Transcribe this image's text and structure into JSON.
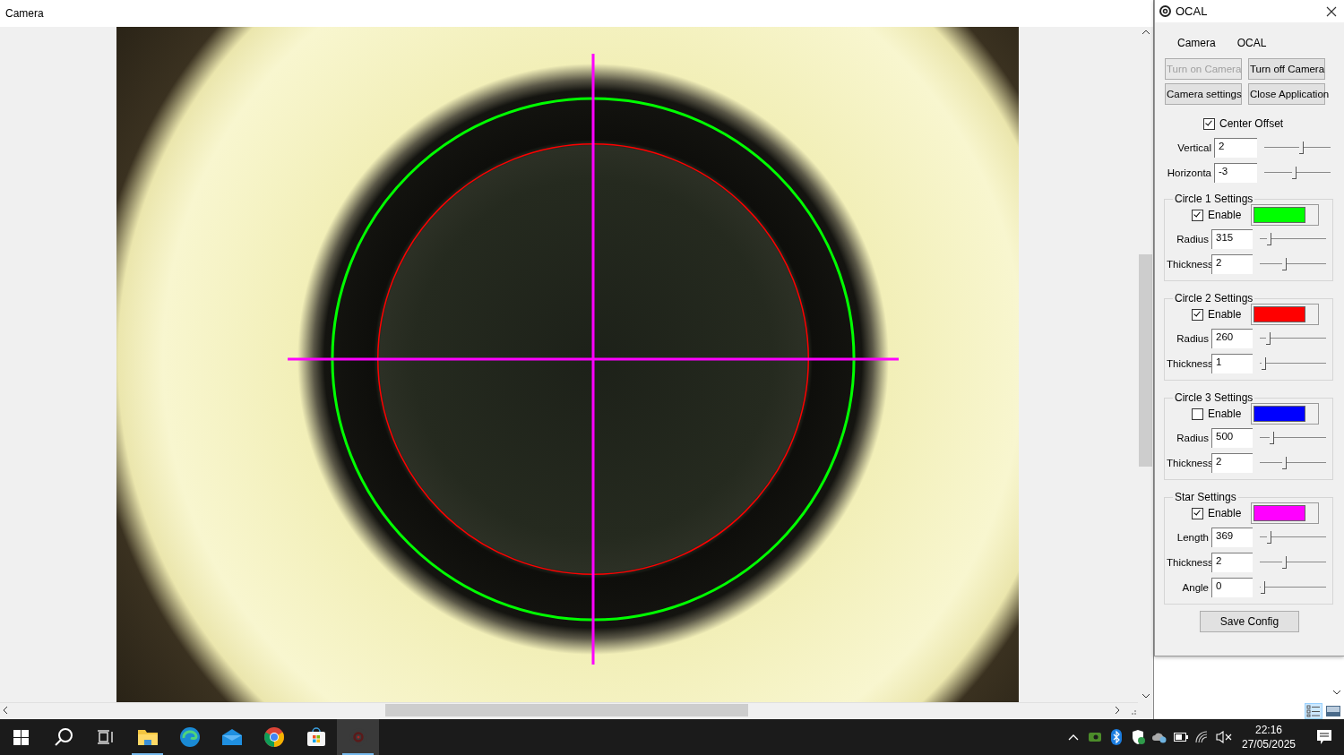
{
  "camera_window": {
    "title": "Camera"
  },
  "ocal_window": {
    "title": "OCAL",
    "tabs": [
      {
        "label": "Camera"
      },
      {
        "label": "OCAL"
      }
    ],
    "buttons": [
      {
        "label": "Turn on Camera",
        "disabled": true
      },
      {
        "label": "Turn off Camera",
        "disabled": false
      },
      {
        "label": "Camera settings",
        "disabled": false
      },
      {
        "label": "Close Application",
        "disabled": false
      }
    ],
    "center_offset": {
      "label": "Center Offset",
      "checked": true,
      "fields": [
        {
          "label": "Vertical",
          "value": "2",
          "level": 0.55
        },
        {
          "label": "Horizonta",
          "value": "-3",
          "level": 0.44
        }
      ]
    },
    "groups": [
      {
        "kind": "circle",
        "title": "Circle 1 Settings",
        "enable_label": "Enable",
        "enabled": true,
        "color": "#00ff00",
        "fields": [
          {
            "label": "Radius",
            "value": "315",
            "level": 0.11
          },
          {
            "label": "Thickness",
            "value": "2",
            "level": 0.36
          }
        ]
      },
      {
        "kind": "circle",
        "title": "Circle 2 Settings",
        "enable_label": "Enable",
        "enabled": true,
        "color": "#ff0000",
        "fields": [
          {
            "label": "Radius",
            "value": "260",
            "level": 0.1
          },
          {
            "label": "Thickness",
            "value": "1",
            "level": 0.03
          }
        ]
      },
      {
        "kind": "circle",
        "title": "Circle 3 Settings",
        "enable_label": "Enable",
        "enabled": false,
        "color": "#0000ff",
        "fields": [
          {
            "label": "Radius",
            "value": "500",
            "level": 0.16
          },
          {
            "label": "Thickness",
            "value": "2",
            "level": 0.36
          }
        ]
      },
      {
        "kind": "star",
        "title": "Star Settings",
        "enable_label": "Enable",
        "enabled": true,
        "color": "#ff00ff",
        "fields": [
          {
            "label": "Length",
            "value": "369",
            "level": 0.12
          },
          {
            "label": "Thickness",
            "value": "2",
            "level": 0.36
          },
          {
            "label": "Angle",
            "value": "0",
            "level": 0.02
          }
        ]
      }
    ],
    "save_button": "Save Config"
  },
  "view_buttons": [
    {
      "kind": "list",
      "selected": true
    },
    {
      "kind": "preview",
      "selected": false
    }
  ],
  "taskbar": {
    "buttons": [
      {
        "kind": "start"
      },
      {
        "kind": "search"
      },
      {
        "kind": "taskview"
      }
    ],
    "apps": [
      {
        "kind": "folder",
        "running": true,
        "selected": false
      },
      {
        "kind": "browser",
        "running": false,
        "selected": false
      },
      {
        "kind": "mail",
        "running": false,
        "selected": false
      },
      {
        "kind": "chrome",
        "running": false,
        "selected": false
      },
      {
        "kind": "store",
        "running": false,
        "selected": false
      },
      {
        "kind": "target",
        "running": true,
        "selected": true
      }
    ],
    "tray": [
      {
        "kind": "chevron"
      },
      {
        "kind": "gpu"
      },
      {
        "kind": "bluetooth"
      },
      {
        "kind": "shield"
      },
      {
        "kind": "cloud"
      },
      {
        "kind": "battery"
      },
      {
        "kind": "wifi"
      },
      {
        "kind": "mute"
      }
    ],
    "time": "22:16",
    "date": "27/05/2025"
  }
}
